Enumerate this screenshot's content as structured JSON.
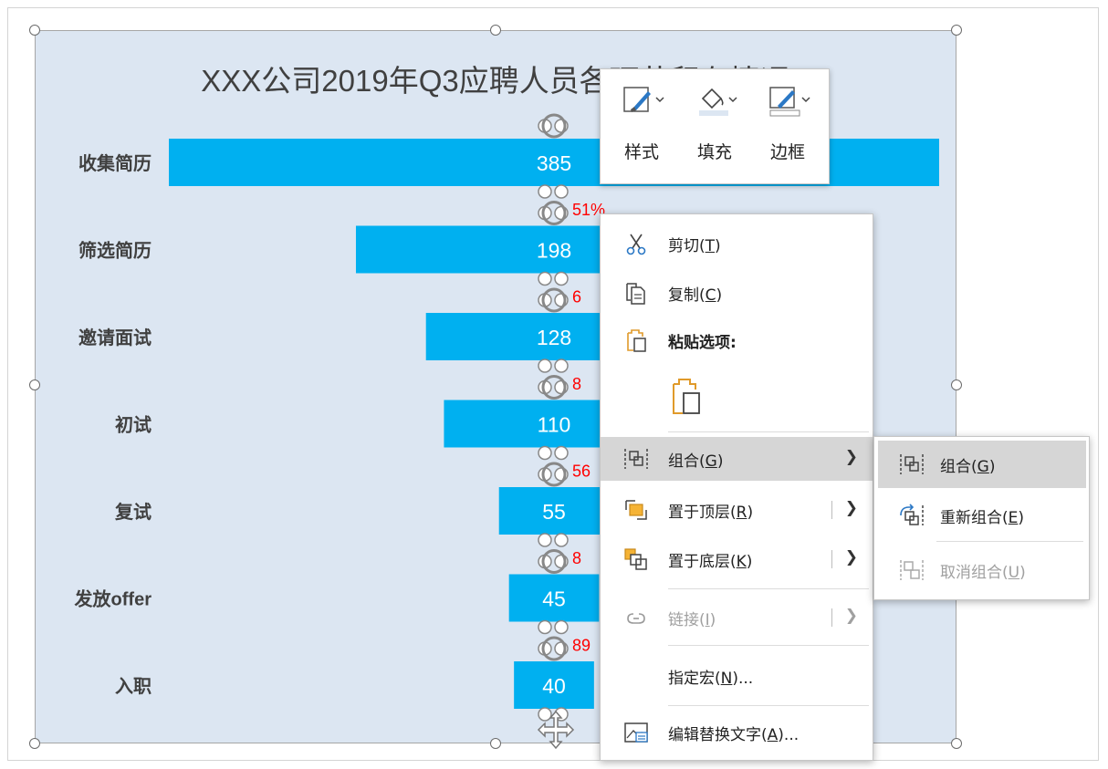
{
  "chart_data": {
    "type": "bar",
    "title": "XXX公司2019年Q3应聘人员各环节留存情况",
    "categories": [
      "收集简历",
      "筛选简历",
      "邀请面试",
      "初试",
      "复试",
      "发放offer",
      "入职"
    ],
    "values": [
      385,
      198,
      128,
      110,
      55,
      45,
      40
    ],
    "conversion_labels_visible": [
      "51%",
      "6",
      "8",
      "56",
      "8",
      "89"
    ],
    "bar_color": "#00b0f0",
    "conversion_color": "#ff0000",
    "xlim": [
      0,
      385
    ],
    "alignment": "centered-funnel",
    "grid": false,
    "legend": "none"
  },
  "mini_toolbar": {
    "style_label": "样式",
    "fill_label": "填充",
    "border_label": "边框"
  },
  "context_menu": {
    "cut": {
      "text": "剪切(",
      "key": "T",
      "tail": ")"
    },
    "copy": {
      "text": "复制(",
      "key": "C",
      "tail": ")"
    },
    "paste_options": "粘贴选项:",
    "group": {
      "text": "组合(",
      "key": "G",
      "tail": ")"
    },
    "bring_to_front": {
      "text": "置于顶层(",
      "key": "R",
      "tail": ")"
    },
    "send_to_back": {
      "text": "置于底层(",
      "key": "K",
      "tail": ")"
    },
    "link": {
      "text": "链接(",
      "key": "I",
      "tail": ")"
    },
    "assign_macro": {
      "text": "指定宏(",
      "key": "N",
      "tail": ")..."
    },
    "edit_alt_text": {
      "text": "编辑替换文字(",
      "key": "A",
      "tail": ")..."
    }
  },
  "submenu": {
    "group": {
      "text": "组合(",
      "key": "G",
      "tail": ")"
    },
    "regroup": {
      "text": "重新组合(",
      "key": "E",
      "tail": ")"
    },
    "ungroup": {
      "text": "取消组合(",
      "key": "U",
      "tail": ")"
    }
  },
  "colors": {
    "chart_bg": "#dce6f2",
    "menu_highlight": "#d6d6d6",
    "accent_orange": "#f0a030"
  }
}
